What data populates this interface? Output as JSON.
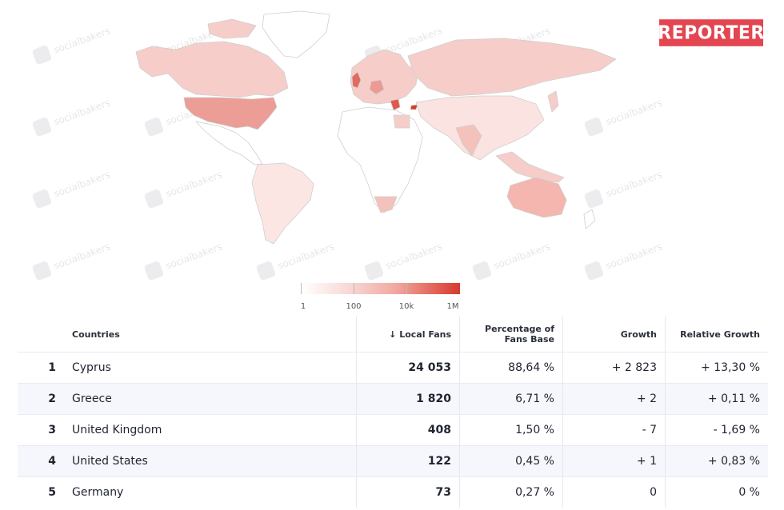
{
  "brand": {
    "logo_text": "REPORTER"
  },
  "watermark": {
    "text": "socialbakers"
  },
  "map": {
    "title": "",
    "color_scale": {
      "min_color": "#ffffff",
      "max_color": "#d63b2e"
    },
    "highlighted_countries": [
      {
        "name": "Cyprus",
        "intensity": 1.0
      },
      {
        "name": "Greece",
        "intensity": 0.65
      },
      {
        "name": "United Kingdom",
        "intensity": 0.5
      },
      {
        "name": "United States",
        "intensity": 0.45
      },
      {
        "name": "Germany",
        "intensity": 0.4
      }
    ]
  },
  "legend": {
    "ticks": [
      "1",
      "100",
      "10k",
      "1M"
    ]
  },
  "table": {
    "headers": {
      "rank": "",
      "country": "Countries",
      "local_fans": "↓ Local Fans",
      "percentage_line1": "Percentage of",
      "percentage_line2": "Fans Base",
      "growth": "Growth",
      "relative_growth": "Relative Growth"
    },
    "rows": [
      {
        "rank": "1",
        "country": "Cyprus",
        "local_fans": "24 053",
        "percentage": "88,64 %",
        "growth": "+ 2 823",
        "relative_growth": "+ 13,30 %"
      },
      {
        "rank": "2",
        "country": "Greece",
        "local_fans": "1 820",
        "percentage": "6,71 %",
        "growth": "+ 2",
        "relative_growth": "+ 0,11 %"
      },
      {
        "rank": "3",
        "country": "United Kingdom",
        "local_fans": "408",
        "percentage": "1,50 %",
        "growth": "- 7",
        "relative_growth": "- 1,69 %"
      },
      {
        "rank": "4",
        "country": "United States",
        "local_fans": "122",
        "percentage": "0,45 %",
        "growth": "+ 1",
        "relative_growth": "+ 0,83 %"
      },
      {
        "rank": "5",
        "country": "Germany",
        "local_fans": "73",
        "percentage": "0,27 %",
        "growth": "0",
        "relative_growth": "0 %"
      }
    ]
  }
}
